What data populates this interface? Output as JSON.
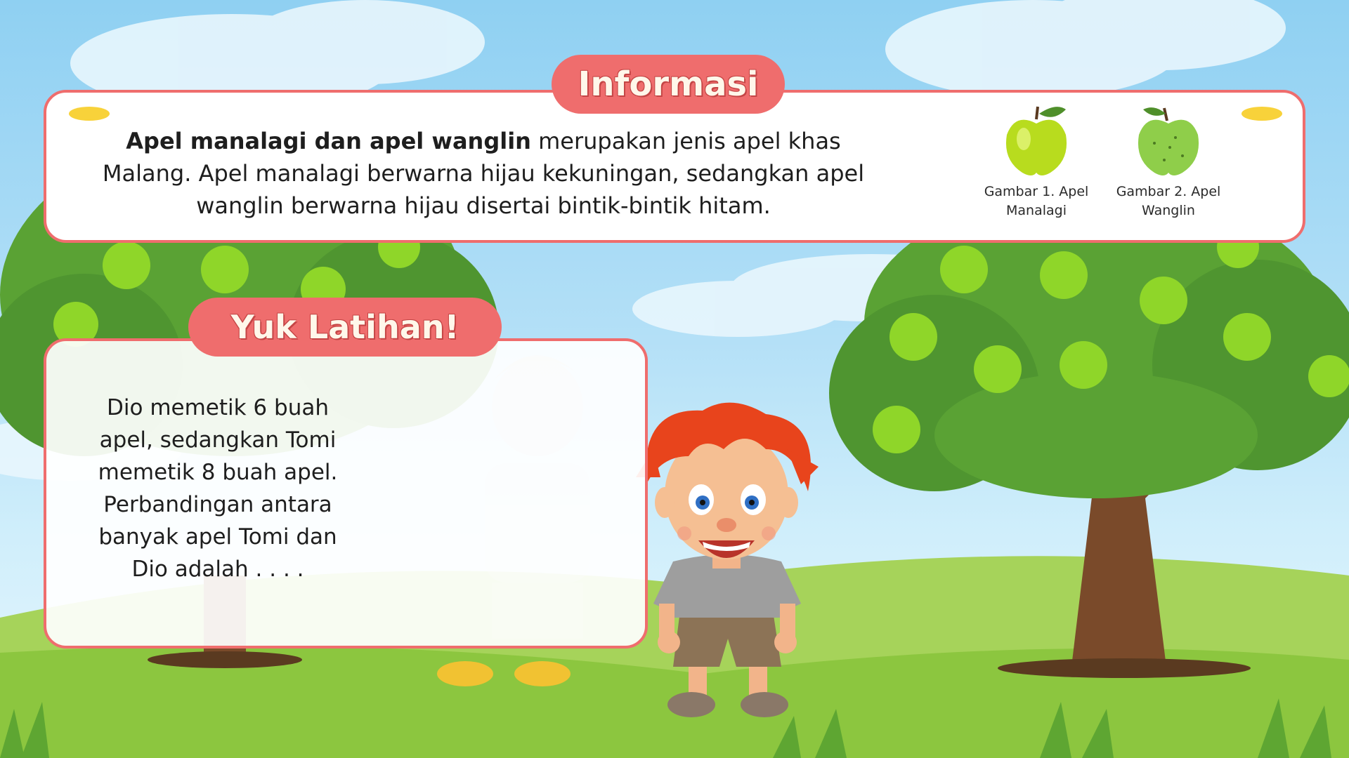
{
  "info": {
    "title": "Informasi",
    "text_bold": "Apel manalagi dan apel wanglin",
    "text_rest": " merupakan jenis apel khas Malang. Apel manalagi berwarna hijau kekuningan, sedangkan apel wanglin berwarna hijau disertai bintik-bintik hitam.",
    "figures": [
      {
        "icon": "manalagi-apple-icon",
        "caption_line1": "Gambar 1. Apel",
        "caption_line2": "Manalagi"
      },
      {
        "icon": "wanglin-apple-icon",
        "caption_line1": "Gambar 2. Apel",
        "caption_line2": "Wanglin"
      }
    ]
  },
  "exercise": {
    "title": "Yuk Latihan!",
    "question": "Dio memetik 6 buah\napel, sedangkan Tomi\nmemetik 8 buah apel.\nPerbandingan antara\nbanyak  apel Tomi dan\nDio adalah . . . ."
  },
  "colors": {
    "accent": "#ef6d6d",
    "sky": "#8fd0f2",
    "grass": "#8cc63f",
    "leaf": "#5aa234",
    "apple": "#8fd629",
    "highlight": "#f8d23a"
  }
}
